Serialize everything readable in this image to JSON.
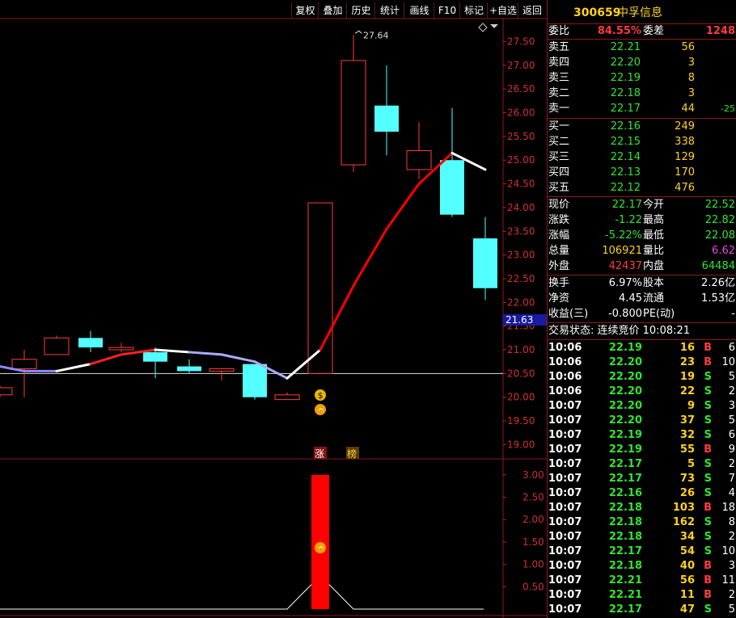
{
  "toolbar": {
    "buttons": [
      "复权",
      "叠加",
      "历史",
      "统计",
      "画线",
      "F10",
      "标记",
      "+自选",
      "返回"
    ]
  },
  "stock": {
    "code": "300659",
    "name": "中孚信息"
  },
  "chart_data": {
    "type": "candlestick",
    "ylim": [
      18.7,
      27.9
    ],
    "y_ticks": [
      "27.50",
      "27.00",
      "26.50",
      "26.00",
      "25.50",
      "25.00",
      "24.50",
      "24.00",
      "23.50",
      "23.00",
      "22.50",
      "22.00",
      "21.50",
      "21.00",
      "20.50",
      "20.00",
      "19.50",
      "19.00"
    ],
    "y_tick_values": [
      27.5,
      27.0,
      26.5,
      26.0,
      25.5,
      25.0,
      24.5,
      24.0,
      23.5,
      23.0,
      22.5,
      22.0,
      21.5,
      21.0,
      20.5,
      20.0,
      19.5,
      19.0
    ],
    "reference_line": 20.5,
    "current_price_label": "21.63",
    "current_price": 21.63,
    "high_label": "27.64",
    "candles": [
      {
        "open": 20.05,
        "close": 20.2,
        "high": 20.25,
        "low": 20.0,
        "up": true
      },
      {
        "open": 20.6,
        "close": 20.8,
        "high": 21.0,
        "low": 20.0,
        "up": true
      },
      {
        "open": 20.9,
        "close": 21.25,
        "high": 21.3,
        "low": 20.9,
        "up": true
      },
      {
        "open": 21.25,
        "close": 21.05,
        "high": 21.4,
        "low": 20.95,
        "up": false
      },
      {
        "open": 21.05,
        "close": 21.0,
        "high": 21.15,
        "low": 20.95,
        "up": true
      },
      {
        "open": 20.95,
        "close": 20.75,
        "high": 21.05,
        "low": 20.4,
        "up": false
      },
      {
        "open": 20.65,
        "close": 20.55,
        "high": 20.8,
        "low": 20.5,
        "up": false
      },
      {
        "open": 20.6,
        "close": 20.55,
        "high": 20.6,
        "low": 20.35,
        "up": true
      },
      {
        "open": 20.7,
        "close": 20.0,
        "high": 20.7,
        "low": 19.95,
        "up": false
      },
      {
        "open": 19.95,
        "close": 20.05,
        "high": 20.1,
        "low": 19.95,
        "up": true
      },
      {
        "open": 20.5,
        "close": 24.1,
        "high": 24.1,
        "low": 20.5,
        "up": true
      },
      {
        "open": 24.9,
        "close": 27.1,
        "high": 27.64,
        "low": 24.75,
        "up": true
      },
      {
        "open": 26.15,
        "close": 25.6,
        "high": 27.0,
        "low": 25.1,
        "up": false
      },
      {
        "open": 24.8,
        "close": 25.2,
        "high": 25.8,
        "low": 24.6,
        "up": true
      },
      {
        "open": 25.0,
        "close": 23.85,
        "high": 26.1,
        "low": 23.8,
        "up": false
      },
      {
        "open": 23.35,
        "close": 22.3,
        "high": 23.8,
        "low": 22.05,
        "up": false
      }
    ],
    "ma_line": [
      20.65,
      20.55,
      20.55,
      20.7,
      20.9,
      21.0,
      20.95,
      20.9,
      20.75,
      20.4,
      21.0,
      22.35,
      23.55,
      24.5,
      25.15,
      24.8
    ],
    "markers": {
      "bag_label": "$",
      "arrow_label": "^",
      "tag_zhang": "涨",
      "tag_bang": "榜"
    },
    "sub_ylim": [
      0,
      3.25
    ],
    "sub_y_ticks": [
      "3.00",
      "2.50",
      "2.00",
      "1.50",
      "1.00",
      "0.50"
    ],
    "sub_y_tick_values": [
      3.0,
      2.5,
      2.0,
      1.5,
      1.0,
      0.5
    ],
    "sub_bar_value": 3.0,
    "sub_bar_index": 10,
    "sub_peak_value": 0.75
  },
  "quote": {
    "weibi_label": "委比",
    "weibi": "84.55%",
    "weicha_label": "委差",
    "weicha": "1248",
    "asks": [
      {
        "label": "卖五",
        "price": "22.21",
        "vol": "56",
        "chg": ""
      },
      {
        "label": "卖四",
        "price": "22.20",
        "vol": "3",
        "chg": ""
      },
      {
        "label": "卖三",
        "price": "22.19",
        "vol": "8",
        "chg": ""
      },
      {
        "label": "卖二",
        "price": "22.18",
        "vol": "3",
        "chg": ""
      },
      {
        "label": "卖一",
        "price": "22.17",
        "vol": "44",
        "chg": "-25"
      }
    ],
    "bids": [
      {
        "label": "买一",
        "price": "22.16",
        "vol": "249"
      },
      {
        "label": "买二",
        "price": "22.15",
        "vol": "338"
      },
      {
        "label": "买三",
        "price": "22.14",
        "vol": "129"
      },
      {
        "label": "买四",
        "price": "22.13",
        "vol": "170"
      },
      {
        "label": "买五",
        "price": "22.12",
        "vol": "476"
      }
    ],
    "stats": [
      {
        "l1": "现价",
        "v1": "22.17",
        "c1": "g",
        "l2": "今开",
        "v2": "22.52",
        "c2": "g"
      },
      {
        "l1": "涨跌",
        "v1": "-1.22",
        "c1": "g",
        "l2": "最高",
        "v2": "22.82",
        "c2": "g"
      },
      {
        "l1": "涨幅",
        "v1": "-5.22%",
        "c1": "g",
        "l2": "最低",
        "v2": "22.08",
        "c2": "g"
      },
      {
        "l1": "总量",
        "v1": "106921",
        "c1": "y",
        "l2": "量比",
        "v2": "6.62",
        "c2": "m"
      },
      {
        "l1": "外盘",
        "v1": "42437",
        "c1": "r",
        "l2": "内盘",
        "v2": "64484",
        "c2": "g"
      }
    ],
    "stats2": [
      {
        "l1": "换手",
        "v1": "6.97%",
        "l2": "股本",
        "v2": "2.26亿"
      },
      {
        "l1": "净资",
        "v1": "4.45",
        "l2": "流通",
        "v2": "1.53亿"
      },
      {
        "l1": "收益(三)",
        "v1": "-0.800",
        "l2": "PE(动)",
        "v2": "-"
      }
    ],
    "trade_status": "交易状态: 连续竞价 10:08:21"
  },
  "ticks": [
    {
      "t": "10:06",
      "p": "22.19",
      "v": "16",
      "bs": "B",
      "n": "6"
    },
    {
      "t": "10:06",
      "p": "22.20",
      "v": "23",
      "bs": "B",
      "n": "10"
    },
    {
      "t": "10:06",
      "p": "22.20",
      "v": "19",
      "bs": "S",
      "n": "5"
    },
    {
      "t": "10:06",
      "p": "22.20",
      "v": "22",
      "bs": "S",
      "n": "2"
    },
    {
      "t": "10:07",
      "p": "22.20",
      "v": "9",
      "bs": "S",
      "n": "3"
    },
    {
      "t": "10:07",
      "p": "22.20",
      "v": "37",
      "bs": "S",
      "n": "5"
    },
    {
      "t": "10:07",
      "p": "22.19",
      "v": "32",
      "bs": "S",
      "n": "6"
    },
    {
      "t": "10:07",
      "p": "22.19",
      "v": "55",
      "bs": "B",
      "n": "9"
    },
    {
      "t": "10:07",
      "p": "22.17",
      "v": "5",
      "bs": "S",
      "n": "2"
    },
    {
      "t": "10:07",
      "p": "22.17",
      "v": "73",
      "bs": "S",
      "n": "7"
    },
    {
      "t": "10:07",
      "p": "22.16",
      "v": "26",
      "bs": "S",
      "n": "4"
    },
    {
      "t": "10:07",
      "p": "22.18",
      "v": "103",
      "bs": "B",
      "n": "18"
    },
    {
      "t": "10:07",
      "p": "22.18",
      "v": "162",
      "bs": "S",
      "n": "8"
    },
    {
      "t": "10:07",
      "p": "22.18",
      "v": "34",
      "bs": "S",
      "n": "2"
    },
    {
      "t": "10:07",
      "p": "22.17",
      "v": "54",
      "bs": "S",
      "n": "10"
    },
    {
      "t": "10:07",
      "p": "22.18",
      "v": "40",
      "bs": "B",
      "n": "3"
    },
    {
      "t": "10:07",
      "p": "22.21",
      "v": "56",
      "bs": "B",
      "n": "11"
    },
    {
      "t": "10:07",
      "p": "22.21",
      "v": "11",
      "bs": "B",
      "n": "2"
    },
    {
      "t": "10:07",
      "p": "22.17",
      "v": "47",
      "bs": "S",
      "n": "5"
    }
  ]
}
